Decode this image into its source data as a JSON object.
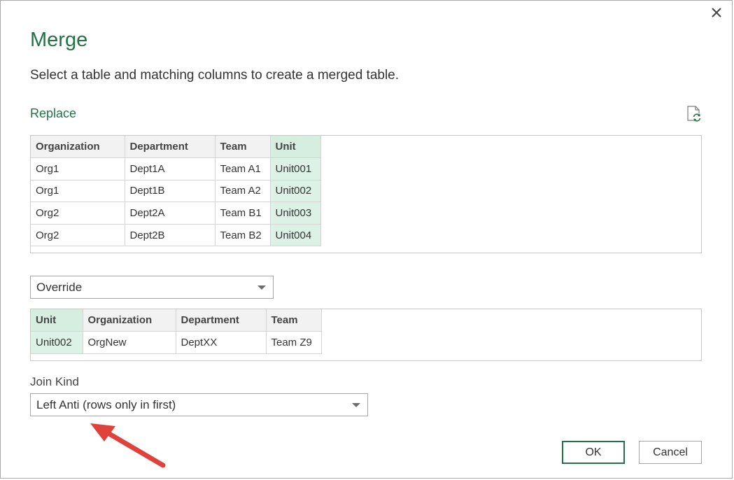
{
  "dialog": {
    "title": "Merge",
    "subtitle": "Select a table and matching columns to create a merged table."
  },
  "first_table": {
    "label": "Replace",
    "columns": [
      "Organization",
      "Department",
      "Team",
      "Unit"
    ],
    "selected_column": "Unit",
    "rows": [
      [
        "Org1",
        "Dept1A",
        "Team A1",
        "Unit001"
      ],
      [
        "Org1",
        "Dept1B",
        "Team A2",
        "Unit002"
      ],
      [
        "Org2",
        "Dept2A",
        "Team B1",
        "Unit003"
      ],
      [
        "Org2",
        "Dept2B",
        "Team B2",
        "Unit004"
      ]
    ]
  },
  "second_table": {
    "selected_query": "Override",
    "columns": [
      "Unit",
      "Organization",
      "Department",
      "Team"
    ],
    "selected_column": "Unit",
    "rows": [
      [
        "Unit002",
        "OrgNew",
        "DeptXX",
        "Team Z9"
      ]
    ]
  },
  "join_kind": {
    "label": "Join Kind",
    "value": "Left Anti (rows only in first)"
  },
  "buttons": {
    "ok": "OK",
    "cancel": "Cancel"
  },
  "colors": {
    "accent": "#217346",
    "selected_column": "#dcf2e6",
    "annotation_arrow": "#e0413a"
  },
  "icons": {
    "close": "close-icon",
    "refresh": "refresh-icon",
    "dropdown": "chevron-down-icon",
    "annotation": "arrow-icon"
  }
}
